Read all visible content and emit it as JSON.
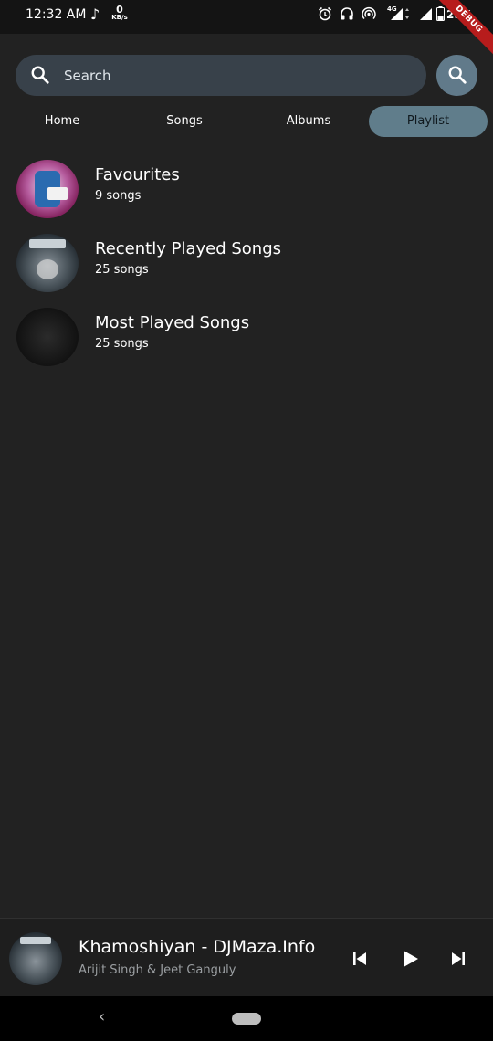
{
  "status_bar": {
    "time": "12:32 AM",
    "net_speed_value": "0",
    "net_speed_unit": "KB/s",
    "network_type": "4G",
    "battery": "29%",
    "icons": [
      "music-note-icon",
      "alarm-icon",
      "headphones-icon",
      "hotspot-icon",
      "signal-icon",
      "battery-icon"
    ]
  },
  "debug_banner": "DEBUG",
  "search": {
    "placeholder": "Search",
    "icon": "search-icon"
  },
  "tabs": [
    {
      "label": "Home",
      "active": false
    },
    {
      "label": "Songs",
      "active": false
    },
    {
      "label": "Albums",
      "active": false
    },
    {
      "label": "Playlist",
      "active": true
    }
  ],
  "playlists": [
    {
      "title": "Favourites",
      "count": "9 songs"
    },
    {
      "title": "Recently Played Songs",
      "count": "25 songs"
    },
    {
      "title": "Most Played Songs",
      "count": "25 songs"
    }
  ],
  "now_playing": {
    "title": "Khamoshiyan - DJMaza.Info",
    "artist": "Arijit Singh & Jeet Ganguly",
    "controls": [
      "previous-icon",
      "play-icon",
      "next-icon"
    ]
  },
  "colors": {
    "background": "#222222",
    "accent": "#607d8b",
    "search_field": "#38414a"
  }
}
